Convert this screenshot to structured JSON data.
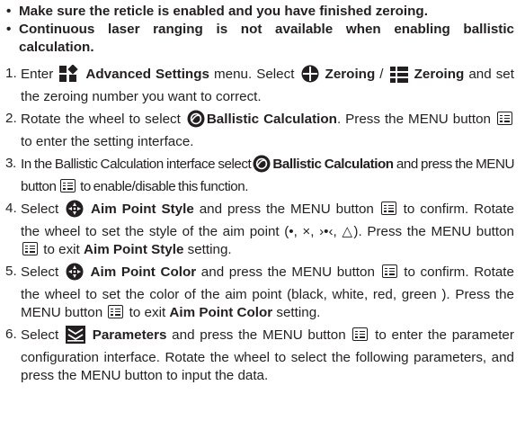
{
  "notes": [
    "Make sure the reticle is enabled and you have finished zeroing.",
    "Continuous laser ranging is not available when enabling ballistic calculation."
  ],
  "bullet_glyph": "•",
  "icons": {
    "advanced_settings": "advanced-settings-icon",
    "zeroing": "zeroing-crosshair-icon",
    "zeroing_alt": "zeroing-grid-icon",
    "ballistic": "ballistic-calculation-icon",
    "aim_style": "aim-point-style-icon",
    "aim_color": "aim-point-color-icon",
    "menu": "menu-button-icon",
    "parameters": "parameters-icon"
  },
  "steps": {
    "s1": {
      "num": "1.",
      "t1": "Enter",
      "t2": "Advanced Settings",
      "t3": "menu. Select",
      "t4": "Zeroing",
      "t5": "/",
      "t6": "Zeroing",
      "t7": "and set the zeroing number you want to correct."
    },
    "s2": {
      "num": "2.",
      "t1": "Rotate the wheel to select",
      "t2": "Ballistic Calculation",
      "t3": ". Press the MENU button",
      "t4": "to enter the setting interface."
    },
    "s3": {
      "num": "3.",
      "t1": "In the Ballistic Calculation interface select",
      "t2": "Ballistic Calculation",
      "t3": "and press the MENU button",
      "t4": "to enable/disable this function."
    },
    "s4": {
      "num": "4.",
      "t1": "Select",
      "t2": "Aim Point Style",
      "t3": "and press the MENU button",
      "t4": "to confirm. Rotate the wheel to set the style of the aim point (•, ×, ›•‹, △). Press the MENU button",
      "t5": "to exit",
      "t6": "Aim Point Style",
      "t7": "setting."
    },
    "s5": {
      "num": "5.",
      "t1": "Select",
      "t2": "Aim Point Color",
      "t3": "and press the MENU button",
      "t4": "to confirm. Rotate the wheel to set the color of the aim point (black, white, red, green ). Press the MENU button",
      "t5": "to exit",
      "t6": "Aim Point Color",
      "t7": "setting."
    },
    "s6": {
      "num": "6.",
      "t1": "Select",
      "t2": "Parameters",
      "t3": "and press the MENU button",
      "t4": "to enter the parameter configuration interface. Rotate the wheel to select the following parameters, and press the MENU button to input the data."
    }
  }
}
